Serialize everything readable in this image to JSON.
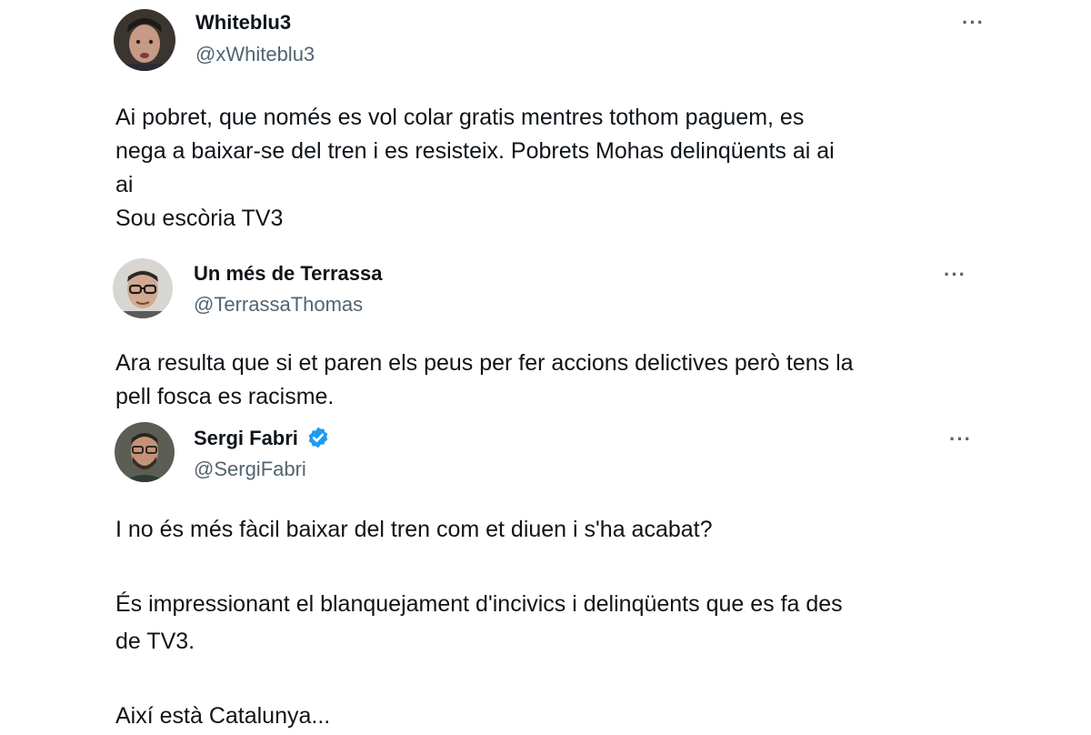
{
  "tweets": [
    {
      "display_name": "Whiteblu3",
      "handle": "@xWhiteblu3",
      "more_label": "···",
      "text": "Ai pobret, que només es vol colar gratis mentres tothom paguem, es\nnega a baixar-se del tren i es resisteix. Pobrets Mohas delinqüents ai ai\nai\nSou escòria TV3",
      "verified": false
    },
    {
      "display_name": "Un més de Terrassa",
      "handle": "@TerrassaThomas",
      "more_label": "···",
      "text": "Ara resulta que si et paren els peus per fer accions delictives però tens la\npell fosca es racisme.",
      "verified": false
    },
    {
      "display_name": "Sergi Fabri",
      "handle": "@SergiFabri",
      "more_label": "···",
      "text": "I no és més fàcil baixar del tren com et diuen i s'ha acabat?\n\nÉs impressionant el blanquejament d'incivics i delinqüents que es fa des\nde TV3.\n\nAixí està Catalunya...",
      "verified": true
    }
  ],
  "colors": {
    "text_primary": "#0f1419",
    "text_secondary": "#536471",
    "verified_badge": "#1d9bf0"
  }
}
